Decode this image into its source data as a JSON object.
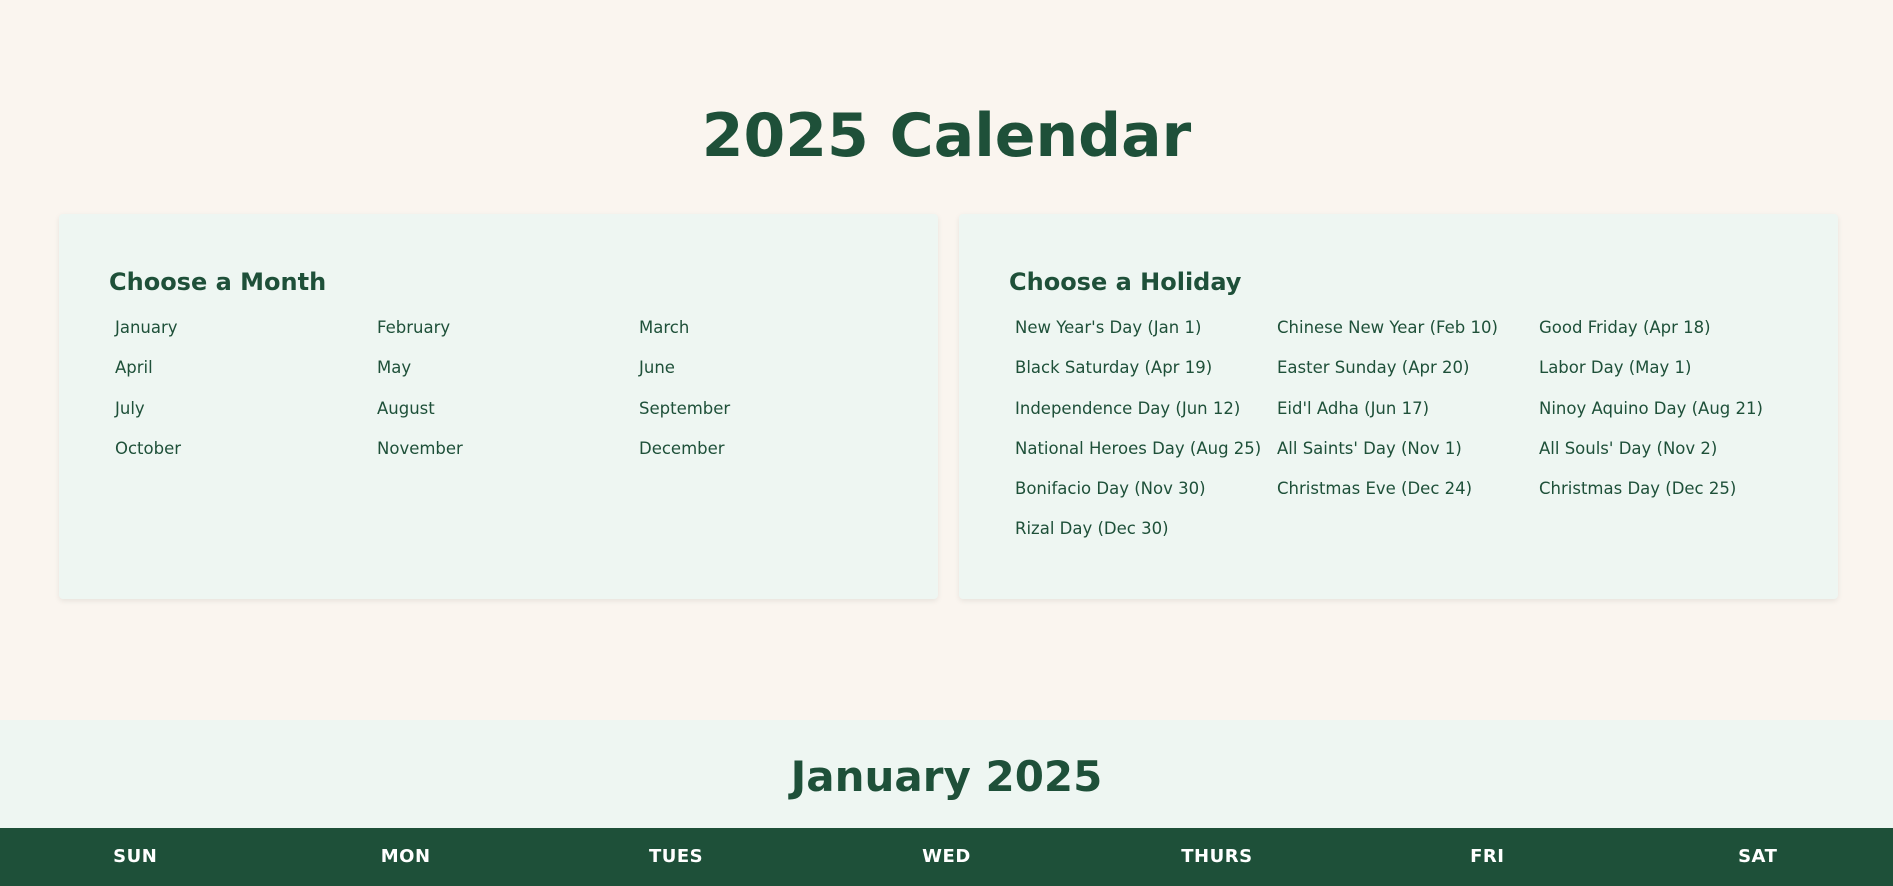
{
  "page": {
    "title": "2025 Calendar"
  },
  "months_panel": {
    "heading": "Choose a Month",
    "items": [
      "January",
      "February",
      "March",
      "April",
      "May",
      "June",
      "July",
      "August",
      "September",
      "October",
      "November",
      "December"
    ]
  },
  "holidays_panel": {
    "heading": "Choose a Holiday",
    "items": [
      "New Year's Day (Jan 1)",
      "Chinese New Year (Feb 10)",
      "Good Friday (Apr 18)",
      "Black Saturday (Apr 19)",
      "Easter Sunday (Apr 20)",
      "Labor Day (May 1)",
      "Independence Day (Jun 12)",
      "Eid'l Adha (Jun 17)",
      "Ninoy Aquino Day (Aug 21)",
      "National Heroes Day (Aug 25)",
      "All Saints' Day (Nov 1)",
      "All Souls' Day (Nov 2)",
      "Bonifacio Day (Nov 30)",
      "Christmas Eve (Dec 24)",
      "Christmas Day (Dec 25)",
      "Rizal Day (Dec 30)"
    ]
  },
  "calendar": {
    "month_title": "January 2025",
    "weekdays": [
      "SUN",
      "MON",
      "TUES",
      "WED",
      "THURS",
      "FRI",
      "SAT"
    ]
  },
  "colors": {
    "background": "#faf5ef",
    "panel": "#eef6f2",
    "accent": "#1e5039",
    "header_text": "#ffffff"
  }
}
